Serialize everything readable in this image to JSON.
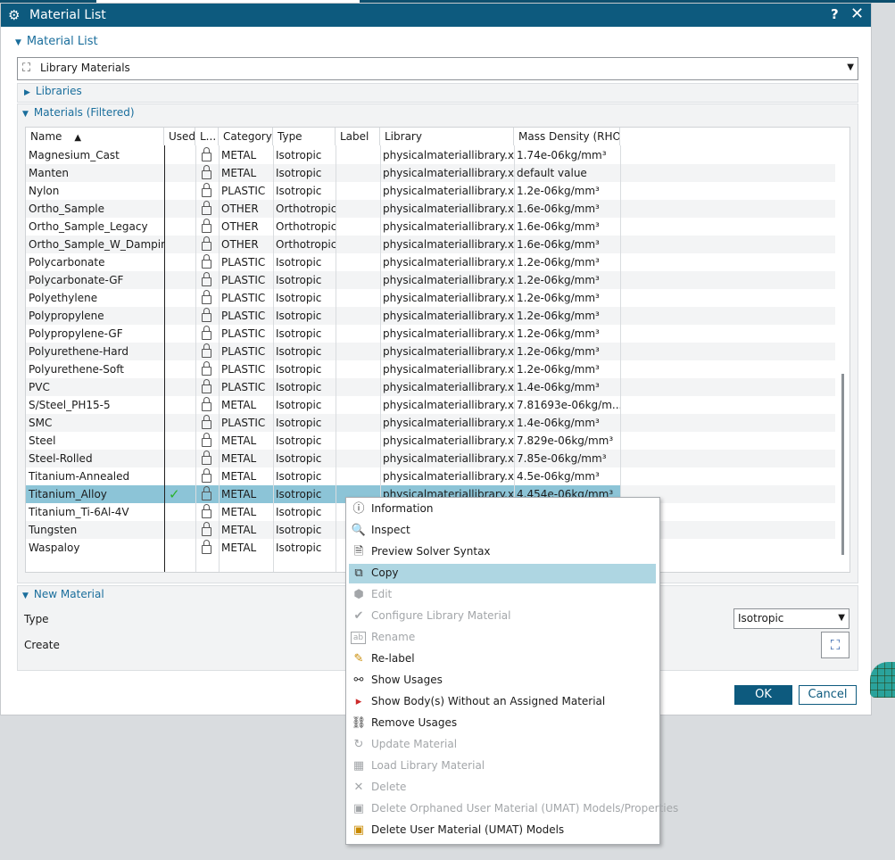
{
  "window": {
    "title": "Material List",
    "help": "?",
    "close": "✕"
  },
  "material_list": {
    "label": "Material List"
  },
  "library_combo": {
    "value": "Library Materials"
  },
  "libraries": {
    "label": "Libraries"
  },
  "materials": {
    "label": "Materials (Filtered)"
  },
  "table": {
    "columns": [
      "Name",
      "Used",
      "L...",
      "Category",
      "Type",
      "Label",
      "Library",
      "Mass Density (RHO)"
    ],
    "sort_indicator": "▲",
    "rows": [
      {
        "name": "Magnesium_Cast",
        "used": "",
        "category": "METAL",
        "type": "Isotropic",
        "label": "",
        "library": "physicalmateriallibrary.xml",
        "density": "1.74e-06kg/mm³"
      },
      {
        "name": "Manten",
        "used": "",
        "category": "METAL",
        "type": "Isotropic",
        "label": "",
        "library": "physicalmateriallibrary.xml",
        "density": "default value"
      },
      {
        "name": "Nylon",
        "used": "",
        "category": "PLASTIC",
        "type": "Isotropic",
        "label": "",
        "library": "physicalmateriallibrary.xml",
        "density": "1.2e-06kg/mm³"
      },
      {
        "name": "Ortho_Sample",
        "used": "",
        "category": "OTHER",
        "type": "Orthotropic",
        "label": "",
        "library": "physicalmateriallibrary.xml",
        "density": "1.6e-06kg/mm³"
      },
      {
        "name": "Ortho_Sample_Legacy",
        "used": "",
        "category": "OTHER",
        "type": "Orthotropic",
        "label": "",
        "library": "physicalmateriallibrary.xml",
        "density": "1.6e-06kg/mm³"
      },
      {
        "name": "Ortho_Sample_W_Damping",
        "used": "",
        "category": "OTHER",
        "type": "Orthotropic",
        "label": "",
        "library": "physicalmateriallibrary.xml",
        "density": "1.6e-06kg/mm³"
      },
      {
        "name": "Polycarbonate",
        "used": "",
        "category": "PLASTIC",
        "type": "Isotropic",
        "label": "",
        "library": "physicalmateriallibrary.xml",
        "density": "1.2e-06kg/mm³"
      },
      {
        "name": "Polycarbonate-GF",
        "used": "",
        "category": "PLASTIC",
        "type": "Isotropic",
        "label": "",
        "library": "physicalmateriallibrary.xml",
        "density": "1.2e-06kg/mm³"
      },
      {
        "name": "Polyethylene",
        "used": "",
        "category": "PLASTIC",
        "type": "Isotropic",
        "label": "",
        "library": "physicalmateriallibrary.xml",
        "density": "1.2e-06kg/mm³"
      },
      {
        "name": "Polypropylene",
        "used": "",
        "category": "PLASTIC",
        "type": "Isotropic",
        "label": "",
        "library": "physicalmateriallibrary.xml",
        "density": "1.2e-06kg/mm³"
      },
      {
        "name": "Polypropylene-GF",
        "used": "",
        "category": "PLASTIC",
        "type": "Isotropic",
        "label": "",
        "library": "physicalmateriallibrary.xml",
        "density": "1.2e-06kg/mm³"
      },
      {
        "name": "Polyurethene-Hard",
        "used": "",
        "category": "PLASTIC",
        "type": "Isotropic",
        "label": "",
        "library": "physicalmateriallibrary.xml",
        "density": "1.2e-06kg/mm³"
      },
      {
        "name": "Polyurethene-Soft",
        "used": "",
        "category": "PLASTIC",
        "type": "Isotropic",
        "label": "",
        "library": "physicalmateriallibrary.xml",
        "density": "1.2e-06kg/mm³"
      },
      {
        "name": "PVC",
        "used": "",
        "category": "PLASTIC",
        "type": "Isotropic",
        "label": "",
        "library": "physicalmateriallibrary.xml",
        "density": "1.4e-06kg/mm³"
      },
      {
        "name": "S/Steel_PH15-5",
        "used": "",
        "category": "METAL",
        "type": "Isotropic",
        "label": "",
        "library": "physicalmateriallibrary.xml",
        "density": "7.81693e-06kg/m..."
      },
      {
        "name": "SMC",
        "used": "",
        "category": "PLASTIC",
        "type": "Isotropic",
        "label": "",
        "library": "physicalmateriallibrary.xml",
        "density": "1.4e-06kg/mm³"
      },
      {
        "name": "Steel",
        "used": "",
        "category": "METAL",
        "type": "Isotropic",
        "label": "",
        "library": "physicalmateriallibrary.xml",
        "density": "7.829e-06kg/mm³"
      },
      {
        "name": "Steel-Rolled",
        "used": "",
        "category": "METAL",
        "type": "Isotropic",
        "label": "",
        "library": "physicalmateriallibrary.xml",
        "density": "7.85e-06kg/mm³"
      },
      {
        "name": "Titanium-Annealed",
        "used": "",
        "category": "METAL",
        "type": "Isotropic",
        "label": "",
        "library": "physicalmateriallibrary.xml",
        "density": "4.5e-06kg/mm³"
      },
      {
        "name": "Titanium_Alloy",
        "used": "✓",
        "category": "METAL",
        "type": "Isotropic",
        "label": "",
        "library": "physicalmateriallibrary.xml",
        "density": "4.454e-06kg/mm³",
        "selected": true
      },
      {
        "name": "Titanium_Ti-6Al-4V",
        "used": "",
        "category": "METAL",
        "type": "Isotropic",
        "label": "",
        "library": "",
        "density": ""
      },
      {
        "name": "Tungsten",
        "used": "",
        "category": "METAL",
        "type": "Isotropic",
        "label": "",
        "library": "",
        "density": ""
      },
      {
        "name": "Waspaloy",
        "used": "",
        "category": "METAL",
        "type": "Isotropic",
        "label": "",
        "library": "",
        "density": ""
      }
    ]
  },
  "new_material": {
    "label": "New Material",
    "type_label": "Type",
    "type_value": "Isotropic",
    "create_label": "Create"
  },
  "buttons": {
    "ok": "OK",
    "cancel": "Cancel"
  },
  "context_menu": [
    {
      "label": "Information",
      "icon": "info-icon",
      "glyph": "ⓘ",
      "disabled": false,
      "highlighted": false
    },
    {
      "label": "Inspect",
      "icon": "inspect-icon",
      "glyph": "🔍",
      "disabled": false,
      "highlighted": false
    },
    {
      "label": "Preview Solver Syntax",
      "icon": "preview-icon",
      "glyph": "🗎",
      "disabled": false,
      "highlighted": false
    },
    {
      "label": "Copy",
      "icon": "copy-icon",
      "glyph": "⧉",
      "disabled": false,
      "highlighted": true
    },
    {
      "label": "Edit",
      "icon": "edit-icon",
      "glyph": "⬢",
      "disabled": true,
      "highlighted": false
    },
    {
      "label": "Configure Library Material",
      "icon": "configure-icon",
      "glyph": "✔",
      "disabled": true,
      "highlighted": false
    },
    {
      "label": "Rename",
      "icon": "rename-icon",
      "glyph": "ab",
      "disabled": true,
      "highlighted": false
    },
    {
      "label": "Re-label",
      "icon": "relabel-icon",
      "glyph": "✎",
      "disabled": false,
      "highlighted": false
    },
    {
      "label": "Show Usages",
      "icon": "link-icon",
      "glyph": "⚯",
      "disabled": false,
      "highlighted": false
    },
    {
      "label": "Show Body(s) Without an Assigned Material",
      "icon": "show-body-icon",
      "glyph": "▸",
      "disabled": false,
      "highlighted": false
    },
    {
      "label": "Remove Usages",
      "icon": "remove-usages-icon",
      "glyph": "⛓",
      "disabled": false,
      "highlighted": false
    },
    {
      "label": "Update Material",
      "icon": "update-icon",
      "glyph": "↻",
      "disabled": true,
      "highlighted": false
    },
    {
      "label": "Load Library Material",
      "icon": "load-library-icon",
      "glyph": "▦",
      "disabled": true,
      "highlighted": false
    },
    {
      "label": "Delete",
      "icon": "delete-icon",
      "glyph": "✕",
      "disabled": true,
      "highlighted": false
    },
    {
      "label": "Delete Orphaned User Material (UMAT) Models/Properties",
      "icon": "delete-orphaned-icon",
      "glyph": "▣",
      "disabled": true,
      "highlighted": false
    },
    {
      "label": "Delete User Material (UMAT) Models",
      "icon": "delete-umat-icon",
      "glyph": "▣",
      "disabled": false,
      "highlighted": false
    }
  ]
}
